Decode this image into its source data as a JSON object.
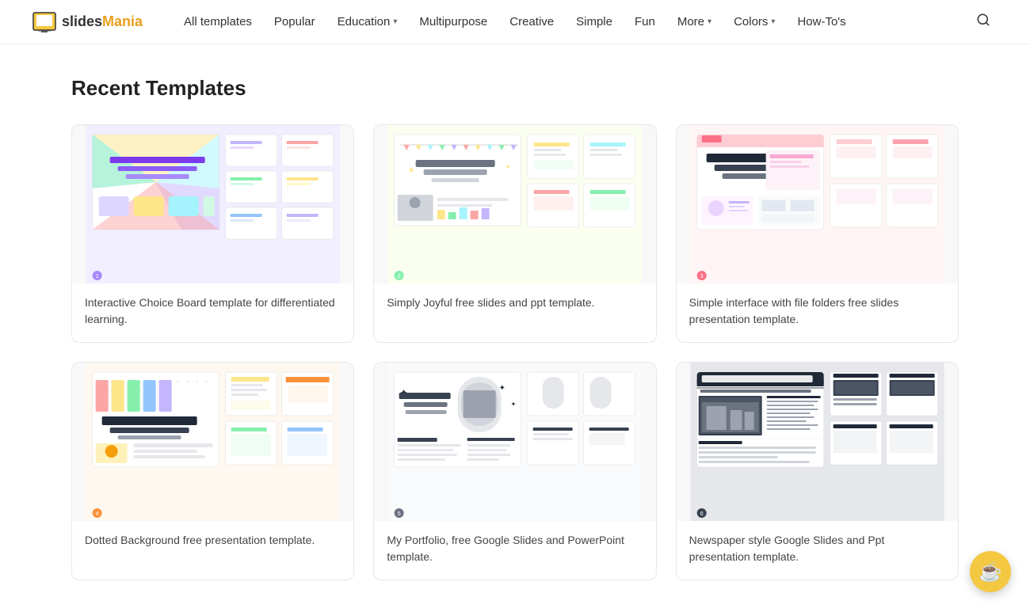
{
  "logo": {
    "slides": "slides",
    "mania": "Mania",
    "icon_label": "slidesMania logo"
  },
  "nav": {
    "all_templates": "All templates",
    "popular": "Popular",
    "education": "Education",
    "multipurpose": "Multipurpose",
    "creative": "Creative",
    "simple": "Simple",
    "fun": "Fun",
    "more": "More",
    "colors": "Colors",
    "how_tos": "How-To's"
  },
  "main": {
    "section_title": "Recent Templates"
  },
  "templates": [
    {
      "id": "choice-board",
      "caption": "Interactive Choice Board template for differentiated learning.",
      "bg": "#eef2ff",
      "accent": "#a78bfa",
      "style": "choice-board"
    },
    {
      "id": "simply-joyful",
      "caption": "Simply Joyful free slides and ppt template.",
      "bg": "#fefce8",
      "accent": "#86efac",
      "style": "joyful"
    },
    {
      "id": "file-folders",
      "caption": "Simple interface with file folders free slides presentation template.",
      "bg": "#fff1f2",
      "accent": "#fda4af",
      "style": "folders"
    },
    {
      "id": "dotted-background",
      "caption": "Dotted Background free presentation template.",
      "bg": "#fff7ed",
      "accent": "#fdba74",
      "style": "dotted"
    },
    {
      "id": "my-portfolio",
      "caption": "My Portfolio, free Google Slides and PowerPoint template.",
      "bg": "#f9fafb",
      "accent": "#9ca3af",
      "style": "portfolio"
    },
    {
      "id": "newspaper",
      "caption": "Newspaper style Google Slides and Ppt presentation template.",
      "bg": "#e5e7eb",
      "accent": "#374151",
      "style": "newspaper"
    }
  ],
  "buy_coffee_label": "☕"
}
